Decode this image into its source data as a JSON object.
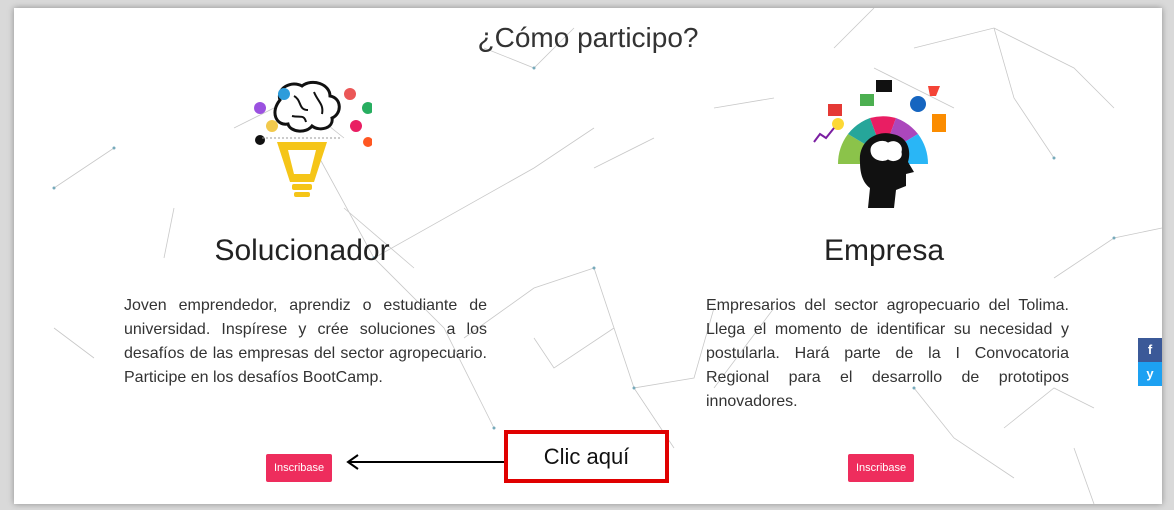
{
  "page": {
    "heading": "¿Cómo participo?"
  },
  "cards": [
    {
      "title": "Solucionador",
      "description": "Joven emprendedor, aprendiz o estudiante de universidad. Inspírese y crée soluciones a los desafíos de las empresas del sector agropecuario. Participe en los desafíos BootCamp.",
      "button_label": "Inscribase",
      "icon": "brain-lightbulb-icon"
    },
    {
      "title": "Empresa",
      "description": "Empresarios del sector agropecuario del Tolima. Llega el momento de identificar su necesidad y postularla. Hará parte de la I Convocatoria Regional para el desarrollo de prototipos innovadores.",
      "button_label": "Inscribase",
      "icon": "head-brain-gears-icon"
    }
  ],
  "annotation": {
    "callout_text": "Clic aquí"
  },
  "social": {
    "facebook_glyph": "f",
    "twitter_glyph": "y"
  },
  "colors": {
    "button": "#ee2d5d",
    "callout_border": "#e00000",
    "facebook": "#3b5998",
    "twitter": "#1da1f2"
  }
}
